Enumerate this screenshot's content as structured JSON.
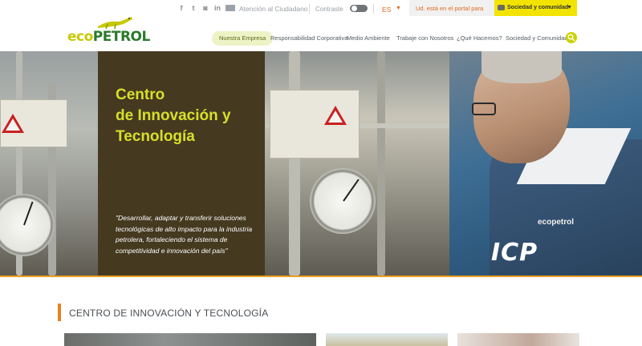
{
  "topbar": {
    "social_icons": [
      "facebook-icon",
      "twitter-icon",
      "instagram-icon",
      "linkedin-icon",
      "mail-icon"
    ],
    "ciudadano_link": "Atención al Ciudadano",
    "contrast_label": "Contraste",
    "language": "ES",
    "portal_label": "Ud. está en el portal para",
    "portal_selected": "Sociedad y comunidad"
  },
  "logo": {
    "part1": "eco",
    "part2": "PETROL"
  },
  "nav": {
    "items": [
      "Nuestra Empresa",
      "Responsabilidad Corporativa",
      "Medio Ambiente",
      "Trabaje con Nosotros",
      "¿Qué Hacemos?",
      "Sociedad y Comunidad"
    ]
  },
  "hero": {
    "title_lines": [
      "Centro",
      "de Innovación y",
      "Tecnología"
    ],
    "quote": "\"Desarrollar, adaptar y transferir soluciones tecnológicas de alto impacto para la industria petrolera, fortaleciendo el sistema de competitividad e innovación del país\"",
    "icp_logo": "ICP",
    "shirt_logo": "ecopetrol"
  },
  "section": {
    "title": "CENTRO DE INNOVACIÓN Y TECNOLOGÍA"
  },
  "colors": {
    "accent_yellow": "#f2e400",
    "accent_orange": "#e6821e",
    "title_green": "#d6e02a",
    "logo_green": "#2a7a2a"
  }
}
